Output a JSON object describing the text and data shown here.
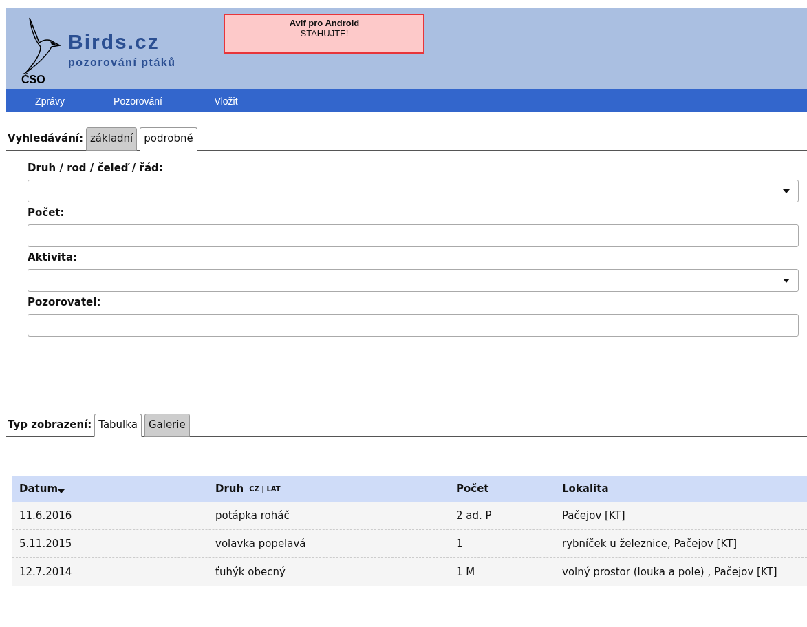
{
  "header": {
    "logo_text": "ČSO",
    "site_title": "Birds.cz",
    "site_subtitle": "pozorování ptáků",
    "banner": {
      "title": "Avif pro Android",
      "subtitle": "STAHUJTE!"
    }
  },
  "nav": [
    {
      "label": "Zprávy"
    },
    {
      "label": "Pozorování"
    },
    {
      "label": "Vložit"
    }
  ],
  "search_tabs": {
    "label": "Vyhledávání:",
    "tabs": [
      {
        "label": "základní",
        "selected": false
      },
      {
        "label": "podrobné",
        "selected": true
      }
    ]
  },
  "fields": [
    {
      "label": "Druh / rod / čeleď / řád:",
      "kind": "select"
    },
    {
      "label": "Počet:",
      "kind": "text"
    },
    {
      "label": "Aktivita:",
      "kind": "select"
    },
    {
      "label": "Pozorovatel:",
      "kind": "text"
    }
  ],
  "view_tabs": {
    "label": "Typ zobrazení:",
    "tabs": [
      {
        "label": "Tabulka",
        "selected": true
      },
      {
        "label": "Galerie",
        "selected": false
      }
    ]
  },
  "table": {
    "columns": [
      {
        "label": "Datum",
        "sorted": true
      },
      {
        "label": "Druh",
        "note": "CZ | LAT",
        "sorted": false
      },
      {
        "label": "Počet",
        "sorted": false
      },
      {
        "label": "Lokalita",
        "sorted": false
      }
    ],
    "rows": [
      [
        "11.6.2016",
        "potápka roháč",
        "2 ad. P",
        "Pačejov [KT]"
      ],
      [
        "5.11.2015",
        "volavka popelavá",
        "1",
        "rybníček u železnice, Pačejov [KT]"
      ],
      [
        "12.7.2014",
        "ťuhýk obecný",
        "1 M",
        "volný prostor (louka a pole) , Pačejov [KT]"
      ]
    ]
  }
}
